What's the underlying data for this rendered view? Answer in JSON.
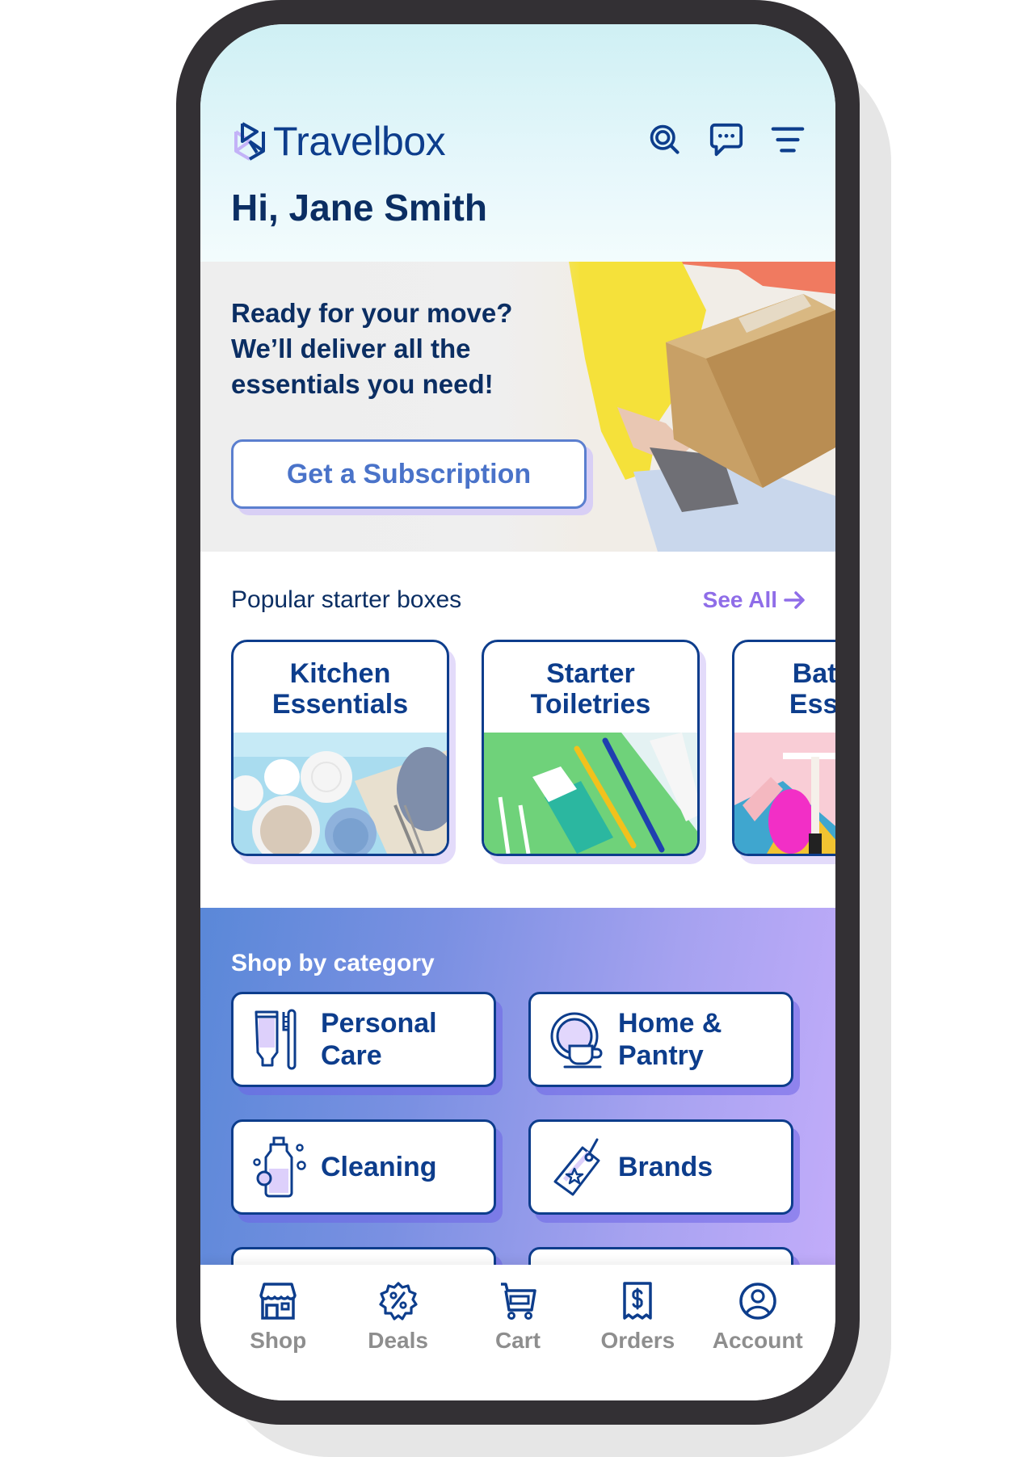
{
  "app": {
    "brand_name": "Travelbox",
    "brand_color": "#0d3d8c",
    "accent_color": "#8f6de8"
  },
  "header": {
    "greeting": "Hi, Jane Smith",
    "icons": [
      "search-icon",
      "chat-icon",
      "menu-icon"
    ]
  },
  "hero": {
    "headline": "Ready for your move? We’ll deliver all the essentials you need!",
    "cta_label": "Get a Subscription"
  },
  "popular": {
    "title": "Popular starter boxes",
    "see_all_label": "See All",
    "boxes": [
      {
        "title": "Kitchen Essentials"
      },
      {
        "title": "Starter Toiletries"
      },
      {
        "title": "Bathroom Essentials"
      }
    ]
  },
  "category": {
    "title": "Shop by category",
    "items": [
      {
        "label": "Personal Care",
        "icon": "toothpaste-icon"
      },
      {
        "label": "Home & Pantry",
        "icon": "plate-cup-icon"
      },
      {
        "label": "Cleaning",
        "icon": "cleaning-bottle-icon"
      },
      {
        "label": "Brands",
        "icon": "price-tag-icon"
      },
      {
        "label": ""
      },
      {
        "label": ""
      }
    ]
  },
  "bottom_nav": {
    "items": [
      {
        "label": "Shop",
        "icon": "store-icon"
      },
      {
        "label": "Deals",
        "icon": "discount-badge-icon"
      },
      {
        "label": "Cart",
        "icon": "cart-icon"
      },
      {
        "label": "Orders",
        "icon": "receipt-icon"
      },
      {
        "label": "Account",
        "icon": "user-circle-icon"
      }
    ]
  }
}
